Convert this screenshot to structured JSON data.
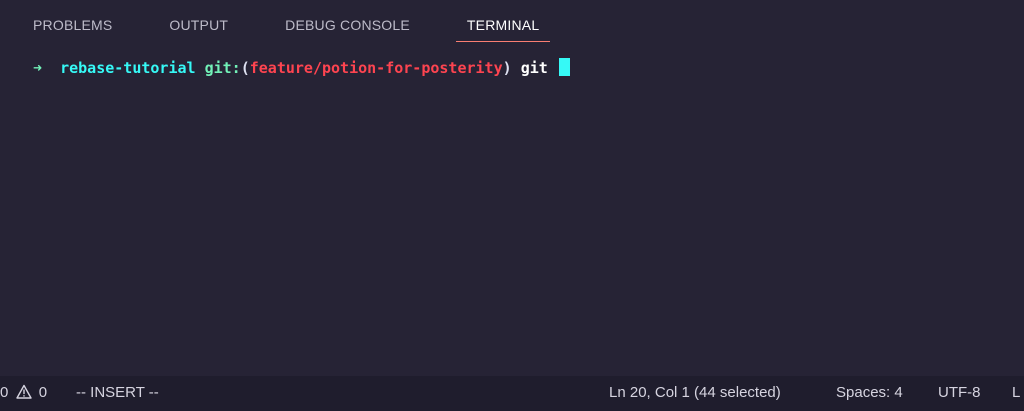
{
  "panel": {
    "tabs": [
      {
        "label": "PROBLEMS"
      },
      {
        "label": "OUTPUT"
      },
      {
        "label": "DEBUG CONSOLE"
      },
      {
        "label": "TERMINAL",
        "active": true
      }
    ]
  },
  "terminal": {
    "arrow": "➜",
    "directory": "rebase-tutorial",
    "git_label": "git:",
    "open_paren": "(",
    "branch": "feature/potion-for-posterity",
    "close_paren": ")",
    "command": "git"
  },
  "statusbar": {
    "errors_count": "0",
    "warnings_count": "0",
    "mode": "-- INSERT --",
    "cursor_position": "Ln 20, Col 1 (44 selected)",
    "indentation": "Spaces: 4",
    "encoding": "UTF-8",
    "line_ending": "L"
  },
  "icons": {
    "warning": "warning-icon"
  },
  "colors": {
    "background": "#262335",
    "statusbar_bg": "#1f1d2d",
    "active_tab_underline": "#f97e72",
    "prompt_arrow": "#72f1b8",
    "directory": "#36f9f6",
    "branch": "#fe4450",
    "cursor": "#36f9f6"
  }
}
